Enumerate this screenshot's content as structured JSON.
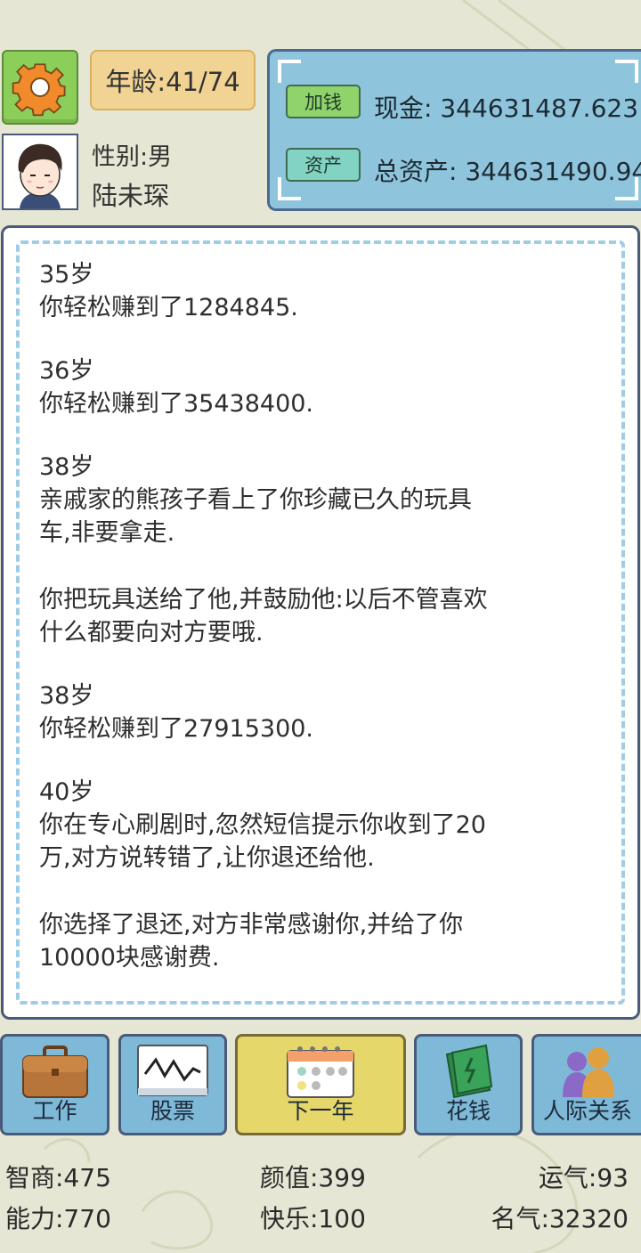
{
  "header": {
    "age_text": "年龄:41/74",
    "gender_text": "性别:男",
    "name": "陆未琛"
  },
  "money": {
    "add_button": "加钱",
    "asset_button": "资产",
    "cash_text": "现金: 344631487.623",
    "total_text": "总资产: 344631490.94"
  },
  "story": [
    {
      "lines": [
        "35岁",
        "你轻松赚到了1284845."
      ]
    },
    {
      "lines": [
        "36岁",
        "你轻松赚到了35438400."
      ]
    },
    {
      "lines": [
        "38岁",
        "亲戚家的熊孩子看上了你珍藏已久的玩具",
        "车,非要拿走."
      ]
    },
    {
      "lines": [
        "你把玩具送给了他,并鼓励他:以后不管喜欢",
        "什么都要向对方要哦."
      ]
    },
    {
      "lines": [
        "38岁",
        "你轻松赚到了27915300."
      ]
    },
    {
      "lines": [
        "40岁",
        "你在专心刷剧时,忽然短信提示你收到了20",
        "万,对方说转错了,让你退还给他."
      ]
    },
    {
      "lines": [
        "你选择了退还,对方非常感谢你,并给了你",
        "10000块感谢费."
      ]
    }
  ],
  "actions": {
    "work": "工作",
    "stocks": "股票",
    "next_year": "下一年",
    "spend": "花钱",
    "relations": "人际关系"
  },
  "stats": {
    "iq": "智商:475",
    "looks": "颜值:399",
    "luck": "运气:93",
    "ability": "能力:770",
    "happiness": "快乐:100",
    "fame": "名气:32320"
  },
  "icons": [
    "gear-icon",
    "avatar-boy",
    "briefcase-icon",
    "stock-chart-icon",
    "calendar-icon",
    "money-stack-icon",
    "people-icon"
  ],
  "colors": {
    "background": "#e6e6d4",
    "gear_button": "#8bcf5a",
    "age_box": "#f1d494",
    "money_panel": "#8ec5dd",
    "action_button": "#7fb9d8",
    "next_year_button": "#e6d76a",
    "dashed_border": "#9fcde6"
  }
}
